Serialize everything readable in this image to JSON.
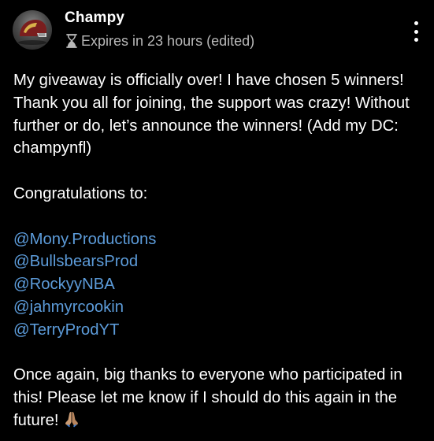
{
  "post": {
    "author": "Champy",
    "expires": "Expires in 23 hours (edited)",
    "paragraphs": {
      "intro": "My giveaway is officially over! I have chosen 5 winners! Thank you all for joining, the support was crazy! Without further or do, let’s announce the winners! (Add my DC: champynfl)",
      "congrats": "Congratulations to:",
      "mentions": [
        "@Mony.Productions",
        "@BullsbearsProd",
        "@RockyyNBA",
        "@jahmyrcookin",
        "@TerryProdYT"
      ],
      "outro": "Once again, big thanks to everyone who participated in this! Please let me know if I should do this again in the future!"
    },
    "emoji_name": "folded-hands-emoji",
    "colors": {
      "background": "#000000",
      "text": "#ffffff",
      "meta": "#b8b8b8",
      "mention": "#5c9bd9"
    }
  }
}
